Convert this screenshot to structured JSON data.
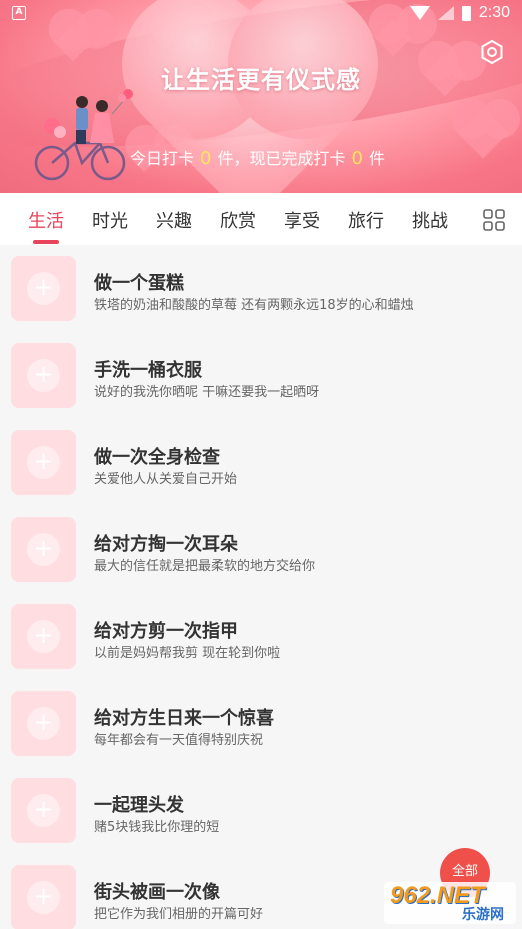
{
  "status_bar": {
    "time": "2:30",
    "left_badge": "A"
  },
  "header": {
    "title": "让生活更有仪式感",
    "checkin_prefix": "今日打卡",
    "checkin_today": "0",
    "checkin_mid": "件，现已完成打卡",
    "checkin_total": "0",
    "checkin_suffix": "件"
  },
  "tabs": [
    {
      "label": "生活",
      "active": true
    },
    {
      "label": "时光"
    },
    {
      "label": "兴趣"
    },
    {
      "label": "欣赏"
    },
    {
      "label": "享受"
    },
    {
      "label": "旅行"
    },
    {
      "label": "挑战"
    }
  ],
  "items": [
    {
      "title": "做一个蛋糕",
      "subtitle": "铁塔的奶油和酸酸的草莓 还有两颗永远18岁的心和蜡烛"
    },
    {
      "title": "手洗一桶衣服",
      "subtitle": "说好的我洗你晒呢 干嘛还要我一起晒呀"
    },
    {
      "title": "做一次全身检查",
      "subtitle": "关爱他人从关爱自己开始"
    },
    {
      "title": "给对方掏一次耳朵",
      "subtitle": "最大的信任就是把最柔软的地方交给你"
    },
    {
      "title": "给对方剪一次指甲",
      "subtitle": "以前是妈妈帮我剪 现在轮到你啦"
    },
    {
      "title": "给对方生日来一个惊喜",
      "subtitle": "每年都会有一天值得特别庆祝"
    },
    {
      "title": "一起理头发",
      "subtitle": "赌5块钱我比你理的短"
    },
    {
      "title": "街头被画一次像",
      "subtitle": "把它作为我们相册的开篇可好"
    }
  ],
  "all_button": "全部",
  "watermark": {
    "main": "962.NET",
    "sub": "乐游网"
  },
  "colors": {
    "accent": "#e8445a",
    "header_pink": "#f77586",
    "thumb_bg": "#ffdde1",
    "all_button": "#f0504a"
  },
  "icons": [
    "settings-icon",
    "grid-icon",
    "plus-icon",
    "wifi-icon",
    "signal-icon",
    "battery-icon"
  ]
}
